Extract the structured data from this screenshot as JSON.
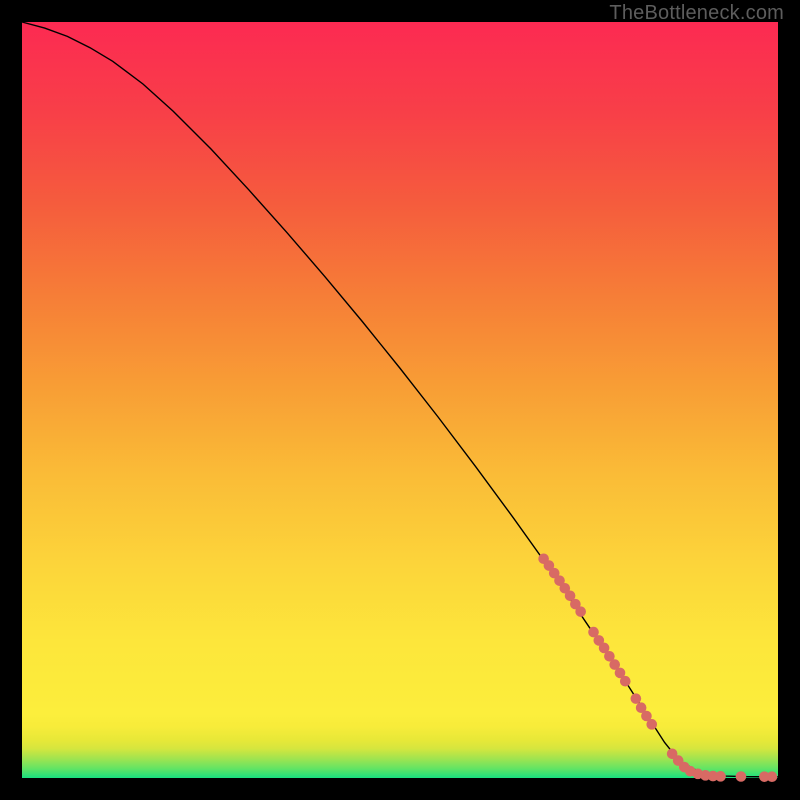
{
  "watermark": "TheBottleneck.com",
  "colors": {
    "dot": "#d86a64",
    "line": "#000000"
  },
  "chart_data": {
    "type": "line",
    "title": "",
    "xlabel": "",
    "ylabel": "",
    "xlim": [
      0,
      100
    ],
    "ylim": [
      0,
      100
    ],
    "grid": false,
    "series": [
      {
        "name": "curve",
        "x": [
          0,
          3,
          6,
          9,
          12,
          16,
          20,
          25,
          30,
          35,
          40,
          45,
          50,
          55,
          60,
          65,
          70,
          75,
          80,
          83,
          85,
          87,
          90,
          93,
          96,
          100
        ],
        "y": [
          100,
          99.2,
          98.1,
          96.6,
          94.8,
          91.8,
          88.2,
          83.2,
          77.8,
          72.2,
          66.4,
          60.4,
          54.2,
          47.8,
          41.2,
          34.4,
          27.4,
          20.0,
          12.5,
          7.8,
          4.7,
          2.2,
          0.6,
          0.25,
          0.18,
          0.15
        ]
      }
    ],
    "dot_clusters": [
      {
        "name": "upper-segment",
        "points": [
          [
            69.0,
            29.0
          ],
          [
            69.7,
            28.1
          ],
          [
            70.4,
            27.1
          ],
          [
            71.1,
            26.1
          ],
          [
            71.8,
            25.1
          ],
          [
            72.5,
            24.1
          ],
          [
            73.2,
            23.0
          ],
          [
            73.9,
            22.0
          ]
        ]
      },
      {
        "name": "mid-segment",
        "points": [
          [
            75.6,
            19.3
          ],
          [
            76.3,
            18.2
          ],
          [
            77.0,
            17.2
          ],
          [
            77.7,
            16.1
          ],
          [
            78.4,
            15.0
          ],
          [
            79.1,
            13.9
          ],
          [
            79.8,
            12.8
          ]
        ]
      },
      {
        "name": "lower-segment",
        "points": [
          [
            81.2,
            10.5
          ],
          [
            81.9,
            9.3
          ],
          [
            82.6,
            8.2
          ],
          [
            83.3,
            7.1
          ]
        ]
      },
      {
        "name": "bottom-right",
        "points": [
          [
            86.0,
            3.2
          ],
          [
            86.8,
            2.3
          ],
          [
            87.6,
            1.45
          ],
          [
            88.4,
            0.9
          ],
          [
            89.4,
            0.55
          ],
          [
            90.4,
            0.35
          ],
          [
            91.4,
            0.25
          ],
          [
            92.4,
            0.22
          ],
          [
            95.1,
            0.2
          ],
          [
            98.2,
            0.18
          ],
          [
            99.2,
            0.17
          ]
        ]
      }
    ]
  }
}
